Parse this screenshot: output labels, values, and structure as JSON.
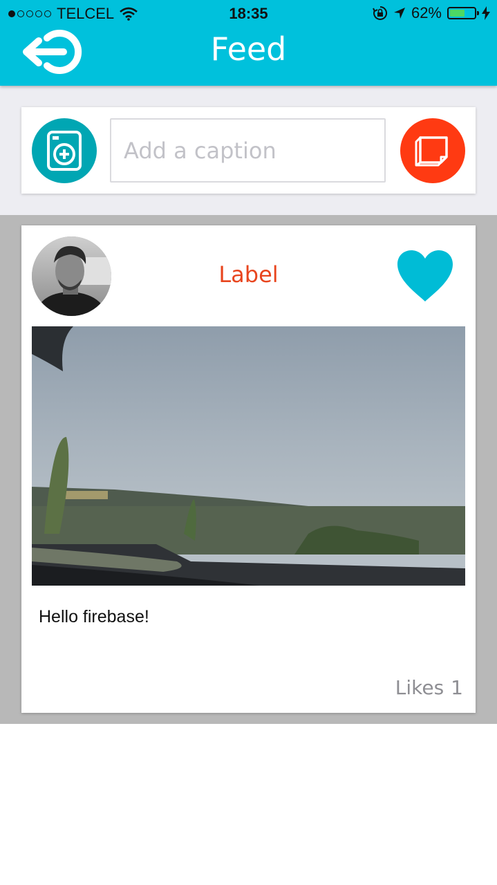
{
  "status_bar": {
    "carrier": "TELCEL",
    "signal_bars": 1,
    "time": "18:35",
    "battery_percent": "62%",
    "battery_level": 0.62,
    "icons": [
      "wifi-icon",
      "rotation-lock-icon",
      "location-arrow-icon",
      "charging-bolt-icon"
    ]
  },
  "header": {
    "title": "Feed",
    "back_icon": "logout-arrow-icon"
  },
  "compose": {
    "caption_placeholder": "Add a caption",
    "caption_value": "",
    "camera_icon": "camera-add-icon",
    "post_icon": "note-icon"
  },
  "post": {
    "label": "Label",
    "text": "Hello firebase!",
    "likes_label": "Likes",
    "likes_count": "1",
    "like_icon": "heart-icon"
  },
  "colors": {
    "primary": "#00c1dc",
    "camera_button": "#00a6b3",
    "post_button": "#ff3a12",
    "label_text": "#e8451e",
    "heart": "#00bcd6"
  }
}
